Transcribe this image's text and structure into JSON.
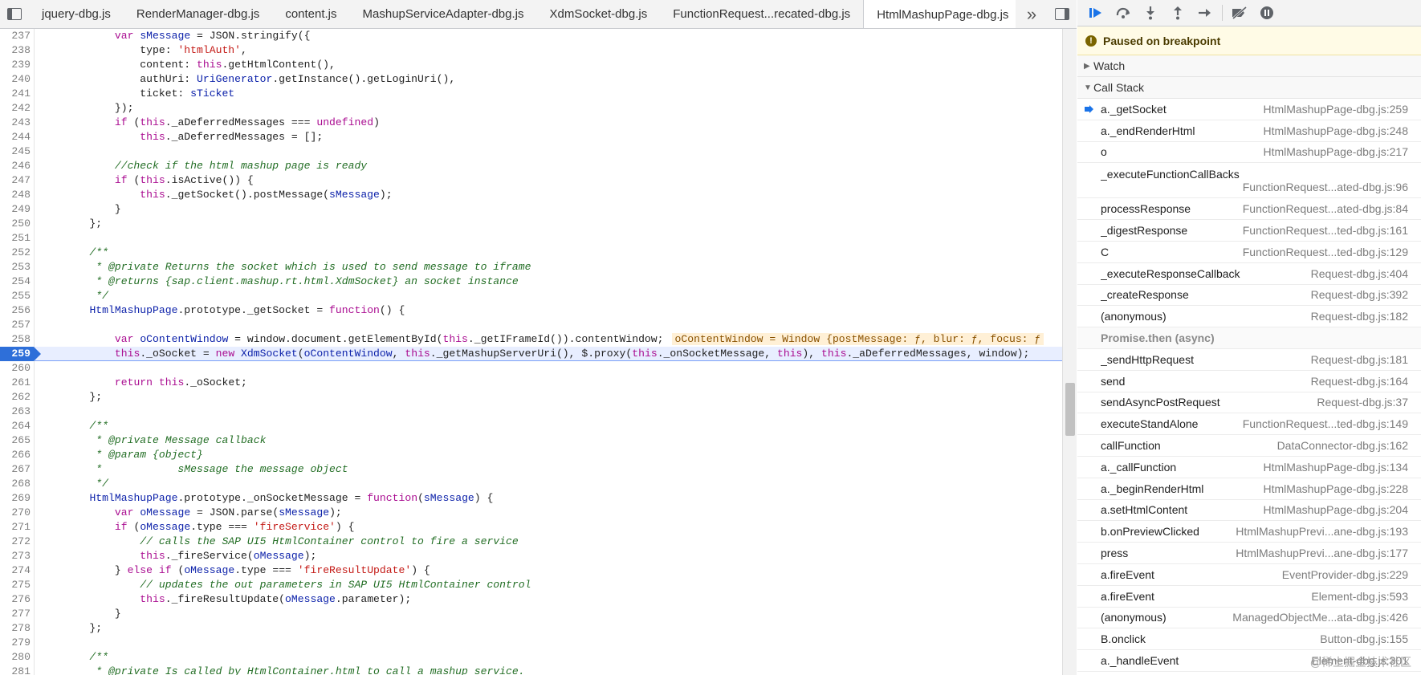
{
  "tabs": [
    {
      "label": "jquery-dbg.js",
      "active": false
    },
    {
      "label": "RenderManager-dbg.js",
      "active": false
    },
    {
      "label": "content.js",
      "active": false
    },
    {
      "label": "MashupServiceAdapter-dbg.js",
      "active": false
    },
    {
      "label": "XdmSocket-dbg.js",
      "active": false
    },
    {
      "label": "FunctionRequest...recated-dbg.js",
      "active": false
    },
    {
      "label": "HtmlMashupPage-dbg.js",
      "active": true
    }
  ],
  "tabbar": {
    "close_glyph": "×",
    "more_glyph": "»"
  },
  "code": {
    "current_line": 259,
    "inline_value": "oContentWindow = Window {postMessage: ƒ, blur: ƒ, focus: ƒ",
    "lines": [
      {
        "n": "237",
        "t": "        var sMessage = JSON.stringify({"
      },
      {
        "n": "238",
        "t": "            type: 'htmlAuth',"
      },
      {
        "n": "239",
        "t": "            content: this.getHtmlContent(),"
      },
      {
        "n": "240",
        "t": "            authUri: UriGenerator.getInstance().getLoginUri(),"
      },
      {
        "n": "241",
        "t": "            ticket: sTicket"
      },
      {
        "n": "242",
        "t": "        });"
      },
      {
        "n": "243",
        "t": "        if (this._aDeferredMessages === undefined)"
      },
      {
        "n": "244",
        "t": "            this._aDeferredMessages = [];"
      },
      {
        "n": "245",
        "t": ""
      },
      {
        "n": "246",
        "t": "        //check if the html mashup page is ready"
      },
      {
        "n": "247",
        "t": "        if (this.isActive()) {"
      },
      {
        "n": "248",
        "t": "            this._getSocket().postMessage(sMessage);"
      },
      {
        "n": "249",
        "t": "        }"
      },
      {
        "n": "250",
        "t": "    };"
      },
      {
        "n": "251",
        "t": ""
      },
      {
        "n": "252",
        "t": "    /**"
      },
      {
        "n": "253",
        "t": "     * @private Returns the socket which is used to send message to iframe"
      },
      {
        "n": "254",
        "t": "     * @returns {sap.client.mashup.rt.html.XdmSocket} an socket instance"
      },
      {
        "n": "255",
        "t": "     */"
      },
      {
        "n": "256",
        "t": "    HtmlMashupPage.prototype._getSocket = function() {"
      },
      {
        "n": "257",
        "t": ""
      },
      {
        "n": "258",
        "t": "        var oContentWindow = window.document.getElementById(this._getIFrameId()).contentWindow;"
      },
      {
        "n": "259",
        "t": "        this._oSocket = new XdmSocket(oContentWindow, this._getMashupServerUri(), $.proxy(this._onSocketMessage, this), this._aDeferredMessages, window);"
      },
      {
        "n": "260",
        "t": ""
      },
      {
        "n": "261",
        "t": "        return this._oSocket;"
      },
      {
        "n": "262",
        "t": "    };"
      },
      {
        "n": "263",
        "t": ""
      },
      {
        "n": "264",
        "t": "    /**"
      },
      {
        "n": "265",
        "t": "     * @private Message callback"
      },
      {
        "n": "266",
        "t": "     * @param {object}"
      },
      {
        "n": "267",
        "t": "     *            sMessage the message object"
      },
      {
        "n": "268",
        "t": "     */"
      },
      {
        "n": "269",
        "t": "    HtmlMashupPage.prototype._onSocketMessage = function(sMessage) {"
      },
      {
        "n": "270",
        "t": "        var oMessage = JSON.parse(sMessage);"
      },
      {
        "n": "271",
        "t": "        if (oMessage.type === 'fireService') {"
      },
      {
        "n": "272",
        "t": "            // calls the SAP UI5 HtmlContainer control to fire a service"
      },
      {
        "n": "273",
        "t": "            this._fireService(oMessage);"
      },
      {
        "n": "274",
        "t": "        } else if (oMessage.type === 'fireResultUpdate') {"
      },
      {
        "n": "275",
        "t": "            // updates the out parameters in SAP UI5 HtmlContainer control"
      },
      {
        "n": "276",
        "t": "            this._fireResultUpdate(oMessage.parameter);"
      },
      {
        "n": "277",
        "t": "        }"
      },
      {
        "n": "278",
        "t": "    };"
      },
      {
        "n": "279",
        "t": ""
      },
      {
        "n": "280",
        "t": "    /**"
      },
      {
        "n": "281",
        "t": "     * @private Is called by HtmlContainer.html to call a mashup service."
      }
    ]
  },
  "debugger": {
    "paused_text": "Paused on breakpoint",
    "paused_icon": "!",
    "watch_label": "Watch",
    "callstack_label": "Call Stack",
    "frames": [
      {
        "fn": "a._getSocket",
        "loc": "HtmlMashupPage-dbg.js:259",
        "current": true
      },
      {
        "fn": "a._endRenderHtml",
        "loc": "HtmlMashupPage-dbg.js:248"
      },
      {
        "fn": "o",
        "loc": "HtmlMashupPage-dbg.js:217"
      },
      {
        "fn": "_executeFunctionCallBacks",
        "loc": "FunctionRequest...ated-dbg.js:96",
        "tall": true
      },
      {
        "fn": "processResponse",
        "loc": "FunctionRequest...ated-dbg.js:84"
      },
      {
        "fn": "_digestResponse",
        "loc": "FunctionRequest...ted-dbg.js:161"
      },
      {
        "fn": "C",
        "loc": "FunctionRequest...ted-dbg.js:129"
      },
      {
        "fn": "_executeResponseCallback",
        "loc": "Request-dbg.js:404"
      },
      {
        "fn": "_createResponse",
        "loc": "Request-dbg.js:392"
      },
      {
        "fn": "(anonymous)",
        "loc": "Request-dbg.js:182"
      },
      {
        "fn": "Promise.then (async)",
        "loc": "",
        "separator": true
      },
      {
        "fn": "_sendHttpRequest",
        "loc": "Request-dbg.js:181"
      },
      {
        "fn": "send",
        "loc": "Request-dbg.js:164"
      },
      {
        "fn": "sendAsyncPostRequest",
        "loc": "Request-dbg.js:37"
      },
      {
        "fn": "executeStandAlone",
        "loc": "FunctionRequest...ted-dbg.js:149"
      },
      {
        "fn": "callFunction",
        "loc": "DataConnector-dbg.js:162"
      },
      {
        "fn": "a._callFunction",
        "loc": "HtmlMashupPage-dbg.js:134"
      },
      {
        "fn": "a._beginRenderHtml",
        "loc": "HtmlMashupPage-dbg.js:228"
      },
      {
        "fn": "a.setHtmlContent",
        "loc": "HtmlMashupPage-dbg.js:204"
      },
      {
        "fn": "b.onPreviewClicked",
        "loc": "HtmlMashupPrevi...ane-dbg.js:193"
      },
      {
        "fn": "press",
        "loc": "HtmlMashupPrevi...ane-dbg.js:177"
      },
      {
        "fn": "a.fireEvent",
        "loc": "EventProvider-dbg.js:229"
      },
      {
        "fn": "a.fireEvent",
        "loc": "Element-dbg.js:593"
      },
      {
        "fn": "(anonymous)",
        "loc": "ManagedObjectMe...ata-dbg.js:426"
      },
      {
        "fn": "B.onclick",
        "loc": "Button-dbg.js:155"
      },
      {
        "fn": "a._handleEvent",
        "loc": "Element-dbg.js:301"
      }
    ]
  },
  "watermark": "@稀土掘金技术社区",
  "colors": {
    "accent": "#1a73e8",
    "current_line_bg": "#e8eeff",
    "paused_bg": "#fffbe6"
  }
}
